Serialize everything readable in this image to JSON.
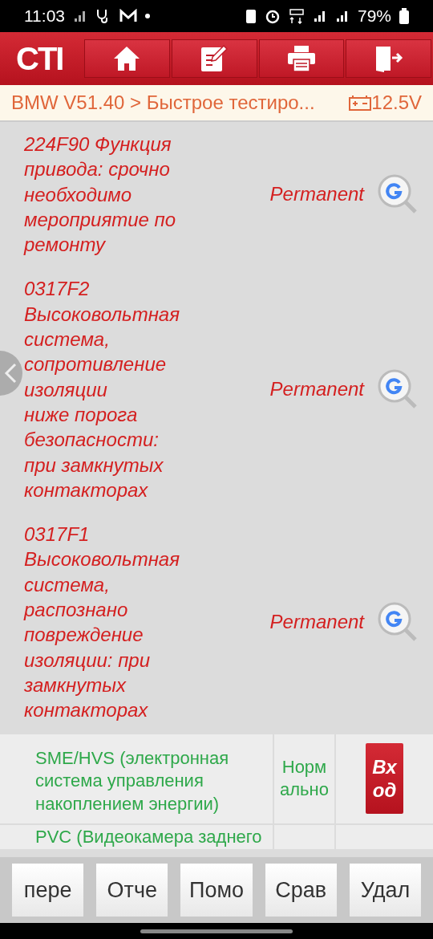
{
  "status_bar": {
    "time": "11:03",
    "battery": "79%"
  },
  "header": {
    "logo": "CTI"
  },
  "breadcrumb": {
    "path": "BMW V51.40 > Быстрое тестиро...",
    "voltage": "12.5V"
  },
  "faults": [
    {
      "text": "224F90 Функция привода: срочно необходимо мероприятие по ремонту",
      "status": "Permanent"
    },
    {
      "text": "0317F2 Высоковольтная система, сопротивление изоляции\nниже порога безопасности: при замкнутых контакторах",
      "status": "Permanent"
    },
    {
      "text": "0317F1 Высоковольтная система, распознано повреждение изоляции: при замкнутых контакторах",
      "status": "Permanent"
    }
  ],
  "systems": [
    {
      "name": "SME/HVS (электронная система управления накоплением энергии)",
      "state": "Норм ально",
      "action": "Вх од"
    },
    {
      "name": "PVC (Видеокамера заднего"
    }
  ],
  "buttons": [
    "пере",
    "Отче",
    "Помо",
    "Срав",
    "Удал"
  ]
}
